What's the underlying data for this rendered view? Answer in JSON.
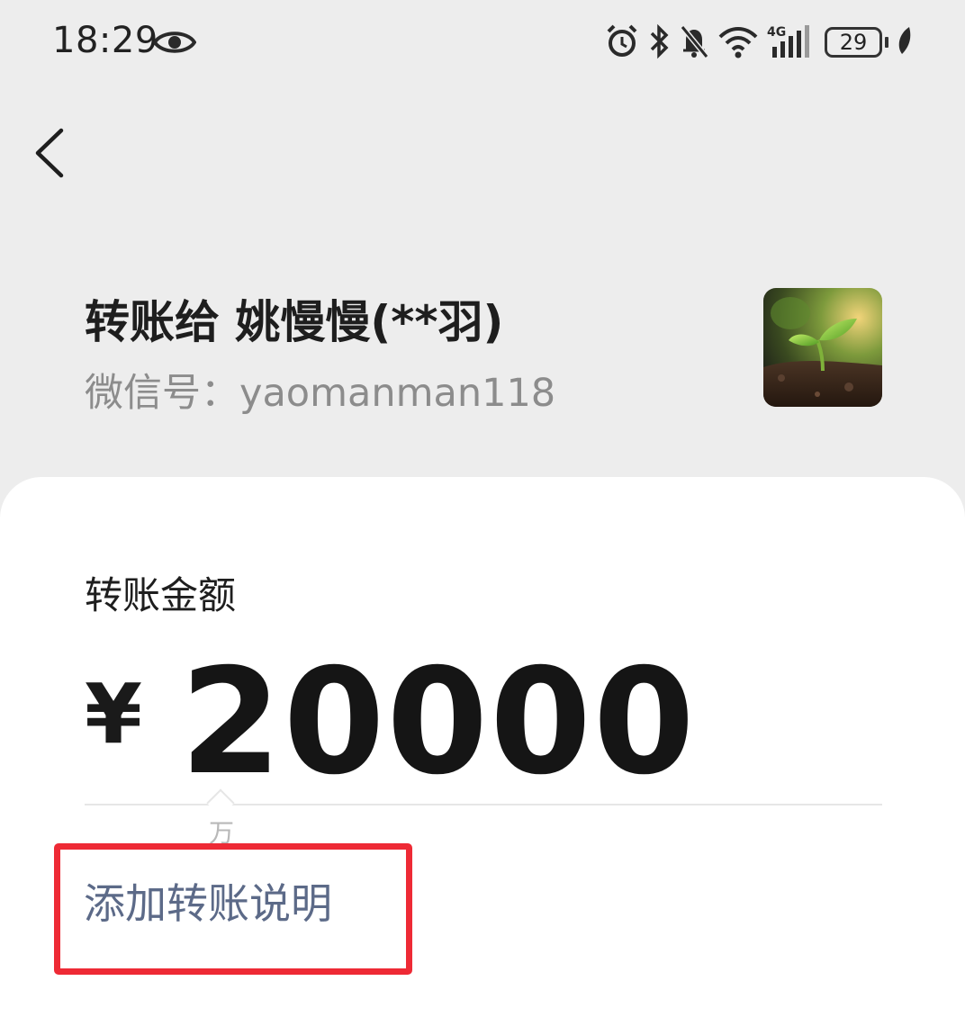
{
  "status_bar": {
    "time": "18:29",
    "network": "4G",
    "battery": "29",
    "icons": [
      "eye-icon",
      "alarm-icon",
      "bluetooth-icon",
      "bell-muted-icon",
      "wifi-icon",
      "signal-icon",
      "battery-icon",
      "leaf-icon"
    ]
  },
  "nav": {
    "back_icon": "chevron-left-icon"
  },
  "payee": {
    "title": "转账给 姚慢慢(**羽)",
    "wechat_id": "微信号：yaomanman118"
  },
  "transfer": {
    "amount_label": "转账金额",
    "currency": "¥",
    "amount": "20000",
    "unit_hint": "万",
    "add_note": "添加转账说明"
  },
  "colors": {
    "background": "#ededed",
    "card": "#ffffff",
    "link": "#5c6a88",
    "highlight": "#ee2a35"
  }
}
